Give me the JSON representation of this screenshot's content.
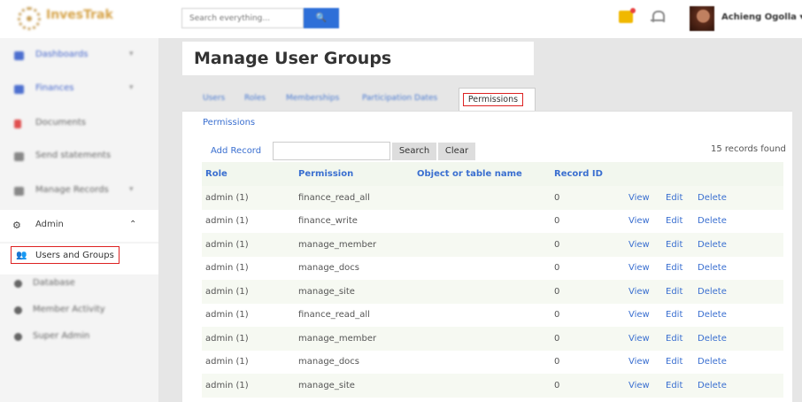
{
  "header": {
    "brand": "InvesTrak",
    "search_placeholder": "Search everything...",
    "search_button": "🔍",
    "user_name": "Achieng Ogolla ▾"
  },
  "sidebar": {
    "items": [
      {
        "label": "Dashboards",
        "chevron": "▾"
      },
      {
        "label": "Finances",
        "chevron": "▾"
      },
      {
        "label": "Documents"
      },
      {
        "label": "Send statements"
      },
      {
        "label": "Manage Records",
        "chevron": "▾"
      },
      {
        "label": "Admin",
        "chevron": "⌃"
      }
    ],
    "active_sub": "Users and Groups",
    "sub_items": [
      "Database",
      "Member Activity",
      "Super Admin"
    ]
  },
  "page": {
    "title": "Manage User Groups",
    "tabs": [
      "Users",
      "Roles",
      "Memberships",
      "Participation Dates",
      "Permissions"
    ],
    "breadcrumb": "Permissions"
  },
  "toolbar": {
    "add_record": "Add Record",
    "search_button": "Search",
    "clear_button": "Clear",
    "records_found": "15 records found"
  },
  "table": {
    "columns": [
      "Role",
      "Permission",
      "Object or table name",
      "Record ID",
      "",
      "",
      ""
    ],
    "rows": [
      {
        "role": "admin (1)",
        "permission": "finance_read_all",
        "object": "",
        "record_id": "0"
      },
      {
        "role": "admin (1)",
        "permission": "finance_write",
        "object": "",
        "record_id": "0"
      },
      {
        "role": "admin (1)",
        "permission": "manage_member",
        "object": "",
        "record_id": "0"
      },
      {
        "role": "admin (1)",
        "permission": "manage_docs",
        "object": "",
        "record_id": "0"
      },
      {
        "role": "admin (1)",
        "permission": "manage_site",
        "object": "",
        "record_id": "0"
      },
      {
        "role": "admin (1)",
        "permission": "finance_read_all",
        "object": "",
        "record_id": "0"
      },
      {
        "role": "admin (1)",
        "permission": "manage_member",
        "object": "",
        "record_id": "0"
      },
      {
        "role": "admin (1)",
        "permission": "manage_docs",
        "object": "",
        "record_id": "0"
      },
      {
        "role": "admin (1)",
        "permission": "manage_site",
        "object": "",
        "record_id": "0"
      }
    ],
    "actions": {
      "view": "View",
      "edit": "Edit",
      "delete": "Delete"
    }
  },
  "colors": {
    "accent": "#2e6fd8",
    "link": "#3a6fd0",
    "highlight_border": "#dd2222"
  }
}
